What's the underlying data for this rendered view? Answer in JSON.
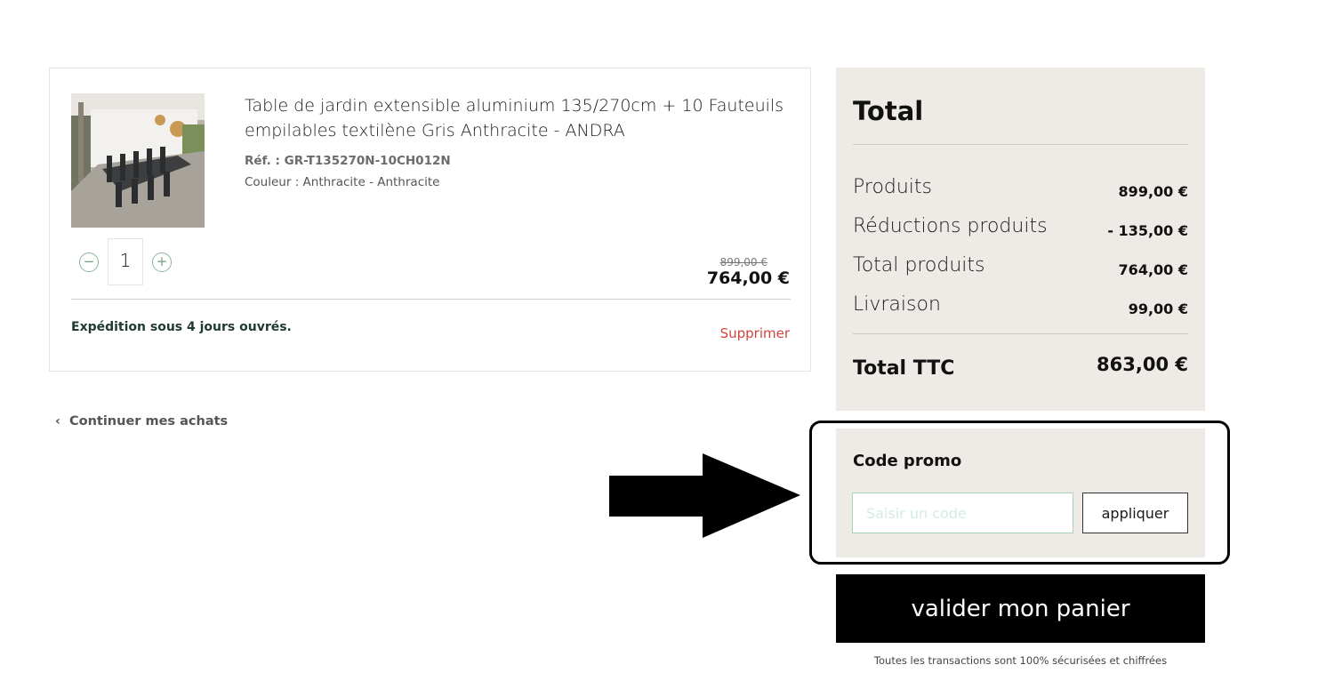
{
  "cart": {
    "item": {
      "image_name": "garden-table-set-photo",
      "title": "Table de jardin extensible aluminium 135/270cm + 10 Fauteuils empilables textilène Gris Anthracite - ANDRA",
      "ref": "Réf. : GR-T135270N-10CH012N",
      "color": "Couleur : Anthracite - Anthracite",
      "quantity": "1",
      "price_old": "899,00 €",
      "price_new": "764,00 €",
      "shipping": "Expédition sous 4 jours ouvrés.",
      "delete_label": "Supprimer"
    },
    "continue_label": "Continuer mes achats"
  },
  "summary": {
    "title": "Total",
    "rows": [
      {
        "label": "Produits",
        "value": "899,00 €"
      },
      {
        "label": "Réductions produits",
        "value": "- 135,00 €"
      },
      {
        "label": "Total produits",
        "value": "764,00 €"
      },
      {
        "label": "Livraison",
        "value": "99,00 €"
      }
    ],
    "total_label": "Total TTC",
    "total_value": "863,00 €"
  },
  "promo": {
    "title": "Code promo",
    "placeholder": "Saisir un code",
    "apply_label": "appliquer"
  },
  "checkout": {
    "validate_label": "valider mon panier",
    "secure_note": "Toutes les transactions sont 100% sécurisées et chiffrées"
  },
  "icons": {
    "minus": "minus-icon",
    "plus": "plus-icon",
    "chevron": "chevron-left-icon",
    "arrow": "arrow-right-icon"
  },
  "colors": {
    "delete": "#d0453f",
    "summary_bg": "#eeeae6",
    "qty_icon": "#6e9e80",
    "button_bg": "#000000"
  }
}
